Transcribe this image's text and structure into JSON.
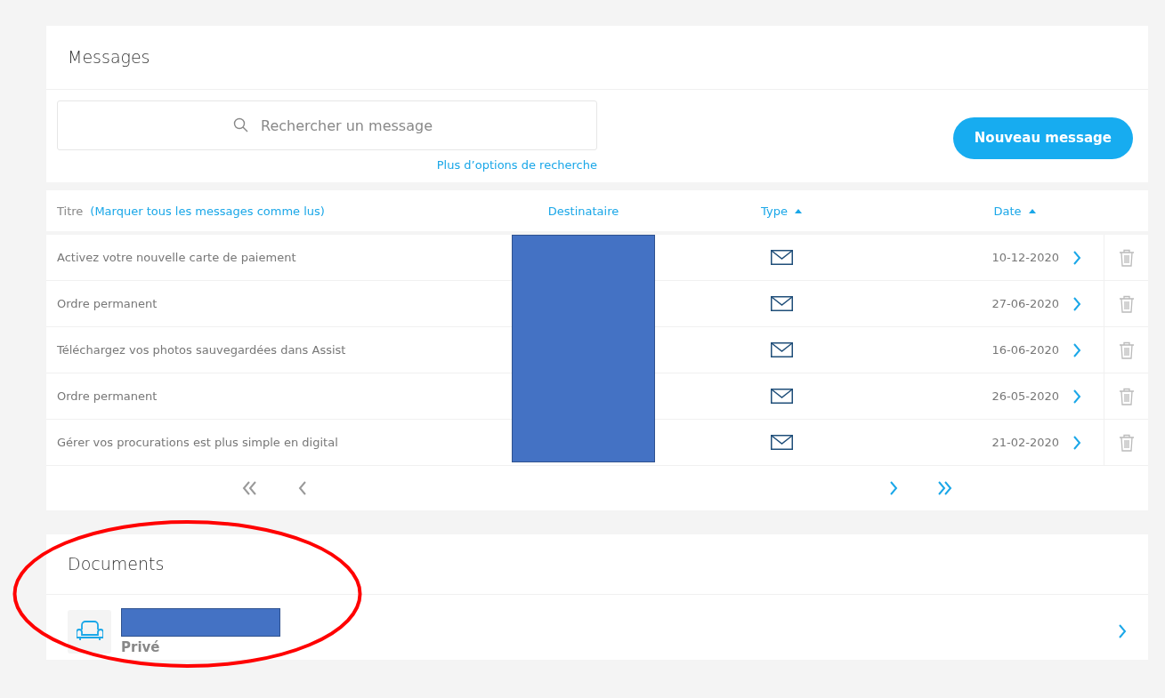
{
  "messages": {
    "title": "Messages",
    "search": {
      "placeholder": "Rechercher un message"
    },
    "more_options": "Plus d’options de recherche",
    "new_button": "Nouveau message",
    "table": {
      "columns": [
        {
          "label": "Titre",
          "sorted": false
        },
        {
          "label": "Destinataire",
          "sorted": false
        },
        {
          "label": "Type",
          "sorted": true
        },
        {
          "label": "Date",
          "sorted": true
        }
      ],
      "mark_all": "(Marquer tous les messages comme lus)",
      "recipient_redacted": true,
      "rows": [
        {
          "title": "Activez votre nouvelle carte de paiement",
          "date": "10-12-2020"
        },
        {
          "title": "Ordre permanent",
          "date": "27-06-2020"
        },
        {
          "title": "Téléchargez vos photos sauvegardées dans Assist",
          "date": "16-06-2020"
        },
        {
          "title": "Ordre permanent",
          "date": "26-05-2020"
        },
        {
          "title": "Gérer vos procurations est plus simple en digital",
          "date": "21-02-2020"
        }
      ]
    },
    "pagination": [
      {
        "kind": "first",
        "disabled": true
      },
      {
        "kind": "prev",
        "disabled": true
      },
      {
        "kind": "next",
        "disabled": false
      },
      {
        "kind": "last",
        "disabled": false
      }
    ]
  },
  "documents": {
    "title": "Documents",
    "items": [
      {
        "title_redacted": true,
        "subtitle": "Privé"
      }
    ]
  },
  "annotation": {
    "circled": true
  }
}
